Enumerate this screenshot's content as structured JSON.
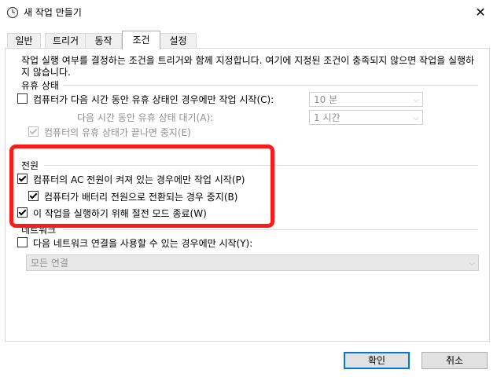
{
  "window": {
    "title": "새 작업 만들기"
  },
  "tabs": [
    {
      "label": "일반"
    },
    {
      "label": "트리거"
    },
    {
      "label": "동작"
    },
    {
      "label": "조건"
    },
    {
      "label": "설정"
    }
  ],
  "active_tab": "조건",
  "description": "작업 실행 여부를 결정하는 조건을 트리거와 함께 지정합니다. 여기에 지정된 조건이 충족되지 않으면 작업을 실행하지 않습니다.",
  "idle": {
    "group_label": "유휴 상태",
    "start_if_idle": {
      "label": "컴퓨터가 다음 시간 동안 유휴 상태인 경우에만 작업 시작(C):",
      "checked": false
    },
    "idle_duration": {
      "value": "10 분"
    },
    "wait_label": "다음 시간 동안 유휴 상태 대기(A):",
    "wait_duration": {
      "value": "1 시간"
    },
    "stop_if_not_idle": {
      "label": "컴퓨터의 유휴 상태가 끝나면 중지(E)",
      "checked": true
    }
  },
  "power": {
    "group_label": "전원",
    "ac_only": {
      "label": "컴퓨터의 AC 전원이 켜져 있는 경우에만 작업 시작(P)",
      "checked": true
    },
    "stop_on_battery": {
      "label": "컴퓨터가 배터리 전원으로 전환되는 경우 중지(B)",
      "checked": true
    },
    "wake_to_run": {
      "label": "이 작업을 실행하기 위해 절전 모드 종료(W)",
      "checked": true
    }
  },
  "network": {
    "group_label": "네트워크",
    "start_if_network": {
      "label": "다음 네트워크 연결을 사용할 수 있는 경우에만 시작(Y):",
      "checked": false
    },
    "connection": {
      "value": "모든 연결"
    }
  },
  "buttons": {
    "ok": "확인",
    "cancel": "취소"
  },
  "colors": {
    "highlight": "#ff1a1a",
    "default_button_border": "#0078d7"
  }
}
